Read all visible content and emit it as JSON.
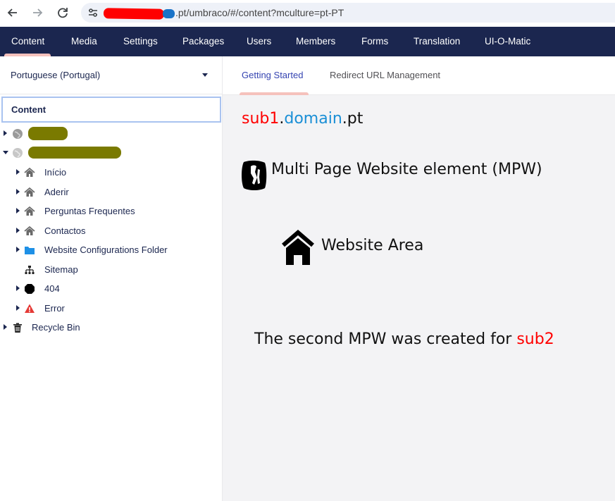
{
  "browser": {
    "back_icon": "arrow-left-icon",
    "forward_icon": "arrow-right-icon",
    "reload_icon": "reload-icon",
    "url_visible": ".pt/umbraco/#/content?mculture=pt-PT"
  },
  "header": {
    "sections": [
      "Content",
      "Media",
      "Settings",
      "Packages",
      "Users",
      "Members",
      "Forms",
      "Translation",
      "UI-O-Matic"
    ],
    "active": "Content",
    "background": "#1b264f",
    "active_indicator": "#f5c1bc"
  },
  "sidebar": {
    "culture": "Portuguese (Portugal)",
    "root_label": "Content",
    "items": [
      {
        "label": "Início",
        "icon": "home-icon"
      },
      {
        "label": "Aderir",
        "icon": "home-icon"
      },
      {
        "label": "Perguntas Frequentes",
        "icon": "home-icon"
      },
      {
        "label": "Contactos",
        "icon": "home-icon"
      },
      {
        "label": "Website Configurations Folder",
        "icon": "folder-icon"
      },
      {
        "label": "Sitemap",
        "icon": "sitemap-icon"
      },
      {
        "label": "404",
        "icon": "octagon-icon"
      },
      {
        "label": "Error",
        "icon": "warning-icon"
      }
    ],
    "recycle_bin": "Recycle Bin"
  },
  "tabs": {
    "getting_started": "Getting Started",
    "redirect": "Redirect URL Management"
  },
  "annotations": {
    "sub1": "sub1",
    "dot1": ".",
    "domain": "domain",
    "tld": ".pt",
    "mpw": "Multi Page Website element (MPW)",
    "website_area": "Website Area",
    "second_mpw": "The second MPW was created for ",
    "sub2": "sub2"
  },
  "colors": {
    "red": "#ff0000",
    "blue": "#1a8fd6"
  }
}
